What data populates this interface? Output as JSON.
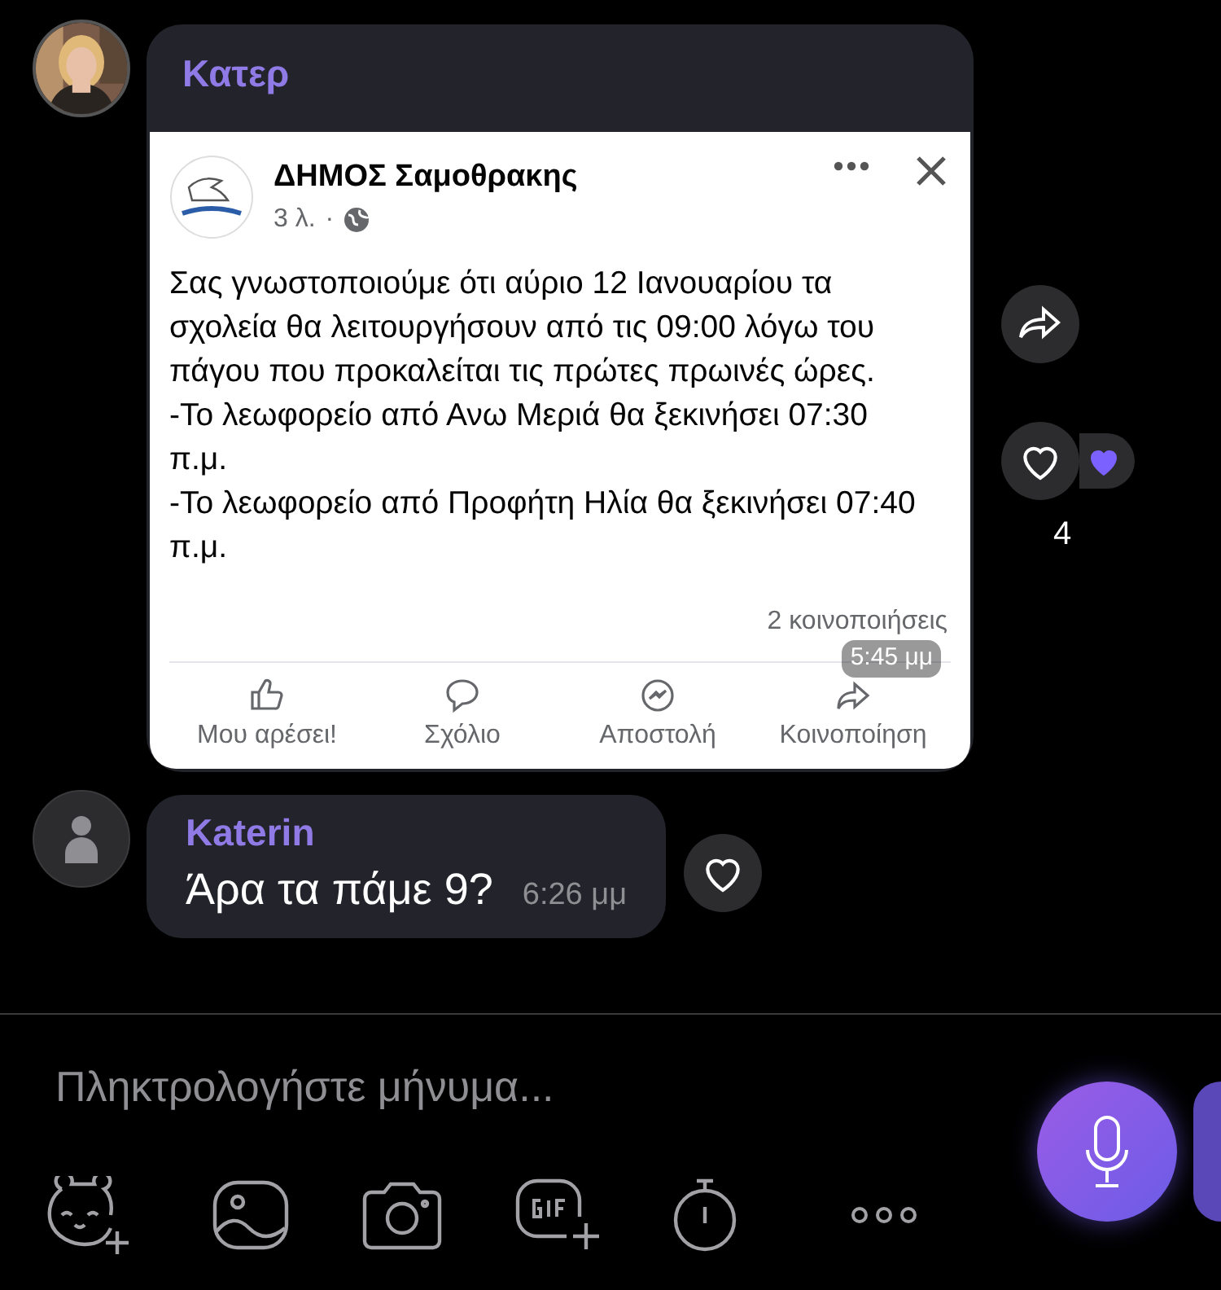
{
  "messages": [
    {
      "kind": "shared_post",
      "sender": "Κατερ",
      "post": {
        "page_name": "ΔΗΜΟΣ Σαμοθρακης",
        "age": "3 λ.",
        "age_separator": "·",
        "paragraphs": [
          "Σας γνωστοποιούμε ότι αύριο 12 Ιανουαρίου τα σχολεία θα λειτουργήσουν από τις 09:00 λόγω του πάγου που προκαλείται τις πρώτες πρωινές ώρες.",
          "-Το λεωφορείο από Ανω Μεριά θα ξεκινήσει 07:30 π.μ.",
          "-Το λεωφορείο από Προφήτη Ηλία θα ξεκινήσει 07:40 π.μ."
        ],
        "shares": "2 κοινοποιήσεις",
        "actions": [
          "Μου αρέσει!",
          "Σχόλιο",
          "Αποστολή",
          "Κοινοποίηση"
        ]
      },
      "time": "5:45 μμ",
      "reaction_count": "4"
    },
    {
      "kind": "text",
      "sender": "Katerin",
      "text": "Άρα τα πάμε 9?",
      "time": "6:26 μμ"
    }
  ],
  "composer": {
    "placeholder": "Πληκτρολογήστε μήνυμα..."
  }
}
